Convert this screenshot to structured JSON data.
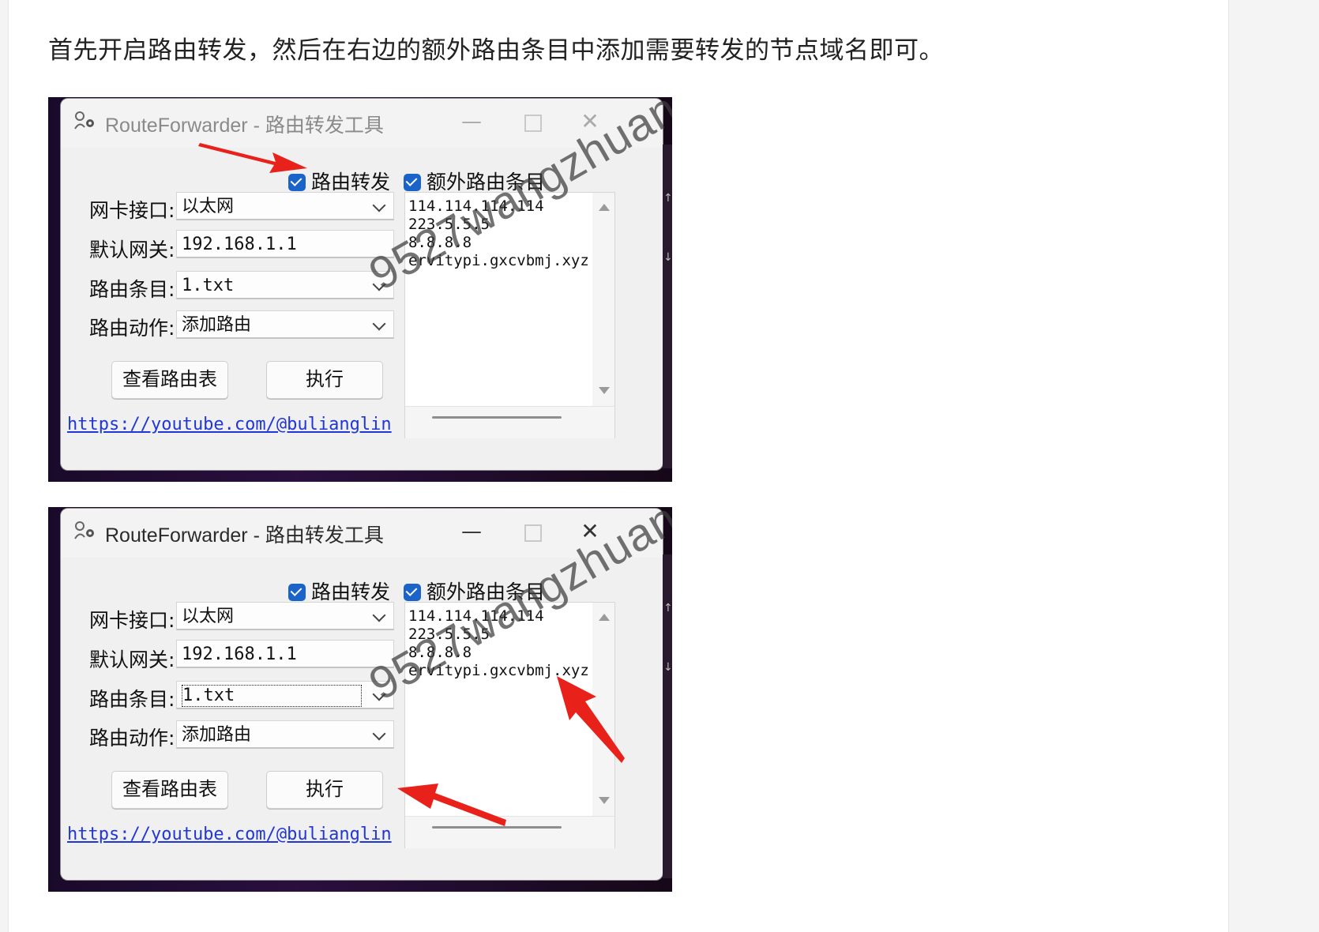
{
  "article": {
    "intro": "首先开启路由转发，然后在右边的额外路由条目中添加需要转发的节点域名即可。"
  },
  "window": {
    "title": "RouteForwarder - 路由转发工具",
    "minimize_glyph": "—",
    "close_glyph": "✕"
  },
  "form": {
    "checkbox_forward": "路由转发",
    "checkbox_extra": "额外路由条目",
    "nic_label": "网卡接口:",
    "nic_value": "以太网",
    "gateway_label": "默认网关:",
    "gateway_value": "192.168.1.1",
    "entries_label": "路由条目:",
    "entries_value": "1.txt",
    "action_label": "路由动作:",
    "action_value": "添加路由",
    "view_button": "查看路由表",
    "execute_button": "执行",
    "link": "https://youtube.com/@bulianglin"
  },
  "extra_routes": [
    "114.114.114.114",
    "223.5.5.5",
    "8.8.8.8",
    "ervitypi.gxcvbmj.xyz"
  ],
  "watermark": "9527wangzhuan",
  "colors": {
    "checkbox": "#1a63c9",
    "link": "#2036d6",
    "annotation_arrow": "#e8221b"
  }
}
